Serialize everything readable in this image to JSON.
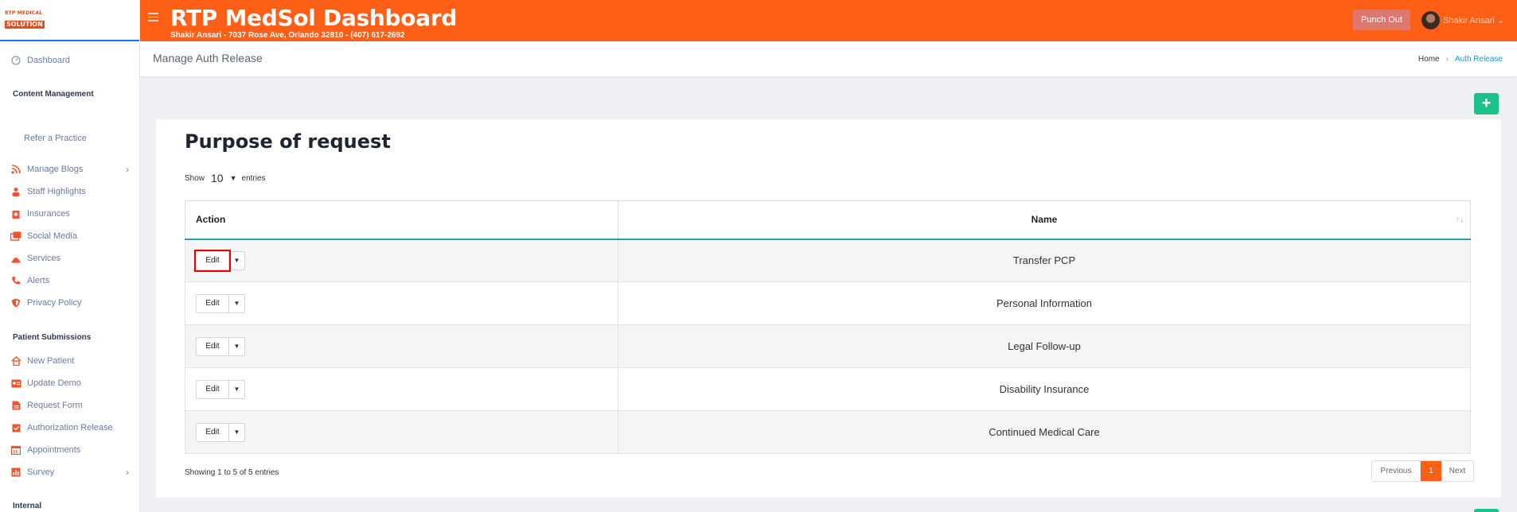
{
  "logo": {
    "line1": "RTP MEDICAL",
    "line2": "SOLUTION"
  },
  "header": {
    "title": "RTP MedSol Dashboard",
    "subtitle": "Shakir Ansari - 7037 Rose Ave, Orlando 32810 - (407) 617-2692",
    "punch_label": "Punch Out",
    "user_name": "Shakir Ansari"
  },
  "sidebar": {
    "dashboard": "Dashboard",
    "section_content": "Content Management",
    "refer": "Refer a Practice",
    "content_items": [
      "Manage Blogs",
      "Staff Highlights",
      "Insurances",
      "Social Media",
      "Services",
      "Alerts",
      "Privacy Policy"
    ],
    "section_patient": "Patient Submissions",
    "patient_items": [
      "New Patient",
      "Update Demo",
      "Request Form",
      "Authorization Release",
      "Appointments",
      "Survey"
    ],
    "section_internal": "Internal"
  },
  "page": {
    "title": "Manage Auth Release",
    "breadcrumb_home": "Home",
    "breadcrumb_current": "Auth Release",
    "add_label": "+"
  },
  "card": {
    "title": "Purpose of request",
    "show_label": "Show",
    "entries_value": "10",
    "entries_label": "entries",
    "col_action": "Action",
    "col_name": "Name",
    "edit_label": "Edit",
    "rows": [
      "Transfer PCP",
      "Personal Information",
      "Legal Follow-up",
      "Disability Insurance",
      "Continued Medical Care"
    ],
    "info": "Showing 1 to 5 of 5 entries",
    "prev": "Previous",
    "page": "1",
    "next": "Next"
  },
  "colors": {
    "brand": "#fe5f17",
    "accent_green": "#1cc08a",
    "link": "#1a9ad6"
  }
}
